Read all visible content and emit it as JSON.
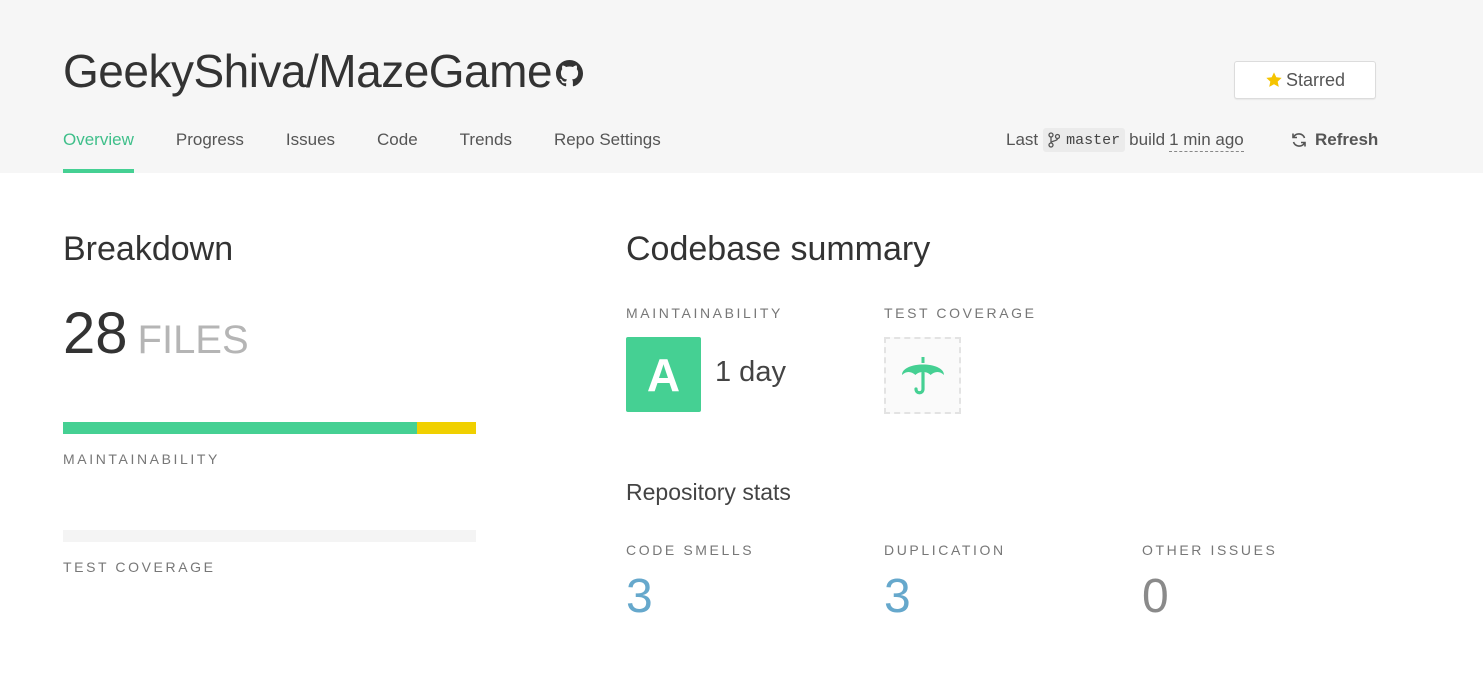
{
  "header": {
    "repo_title": "GeekyShiva/MazeGame",
    "starred_label": "Starred",
    "tabs": [
      {
        "label": "Overview"
      },
      {
        "label": "Progress"
      },
      {
        "label": "Issues"
      },
      {
        "label": "Code"
      },
      {
        "label": "Trends"
      },
      {
        "label": "Repo Settings"
      }
    ],
    "build": {
      "prefix": "Last",
      "branch": "master",
      "middle": "build",
      "time": "1 min ago"
    },
    "refresh_label": "Refresh"
  },
  "breakdown": {
    "title": "Breakdown",
    "files_count": "28",
    "files_unit": "FILES",
    "maintainability_label": "MAINTAINABILITY",
    "maintainability_green_fraction": 0.857,
    "test_coverage_label": "TEST COVERAGE"
  },
  "summary": {
    "title": "Codebase summary",
    "maintainability_label": "MAINTAINABILITY",
    "grade": "A",
    "grade_time": "1 day",
    "test_coverage_label": "TEST COVERAGE",
    "repo_stats_title": "Repository stats",
    "stats": [
      {
        "label": "CODE SMELLS",
        "value": "3"
      },
      {
        "label": "DUPLICATION",
        "value": "3"
      },
      {
        "label": "OTHER ISSUES",
        "value": "0"
      }
    ]
  },
  "colors": {
    "accent_green": "#45d093",
    "warning_yellow": "#f0d000",
    "stat_blue": "#66a8cc",
    "stat_gray": "#8a8a8a",
    "star_yellow": "#f5c400"
  },
  "icons": {
    "github": "github-icon",
    "star": "star-icon",
    "branch": "git-branch-icon",
    "refresh": "refresh-icon",
    "umbrella": "umbrella-icon"
  }
}
